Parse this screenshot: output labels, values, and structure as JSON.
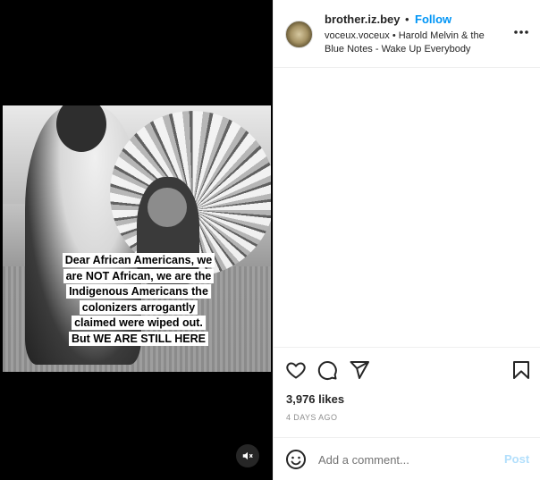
{
  "post": {
    "username": "brother.iz.bey",
    "separator": "•",
    "follow_label": "Follow",
    "audio_line": "voceux.voceux • Harold Melvin & the Blue Notes - Wake Up Everybody",
    "more_icon": "more-horizontal-icon"
  },
  "media": {
    "caption_lines": [
      "Dear African Americans, we",
      "are NOT African, we are the",
      "Indigenous Americans the",
      "colonizers arrogantly",
      "claimed were wiped out.",
      "But WE ARE STILL HERE"
    ],
    "mute_icon": "speaker-muted-icon"
  },
  "actions": {
    "icons": [
      "heart-icon",
      "comment-icon",
      "share-icon",
      "bookmark-icon"
    ],
    "likes": "3,976 likes",
    "date": "4 DAYS AGO"
  },
  "comment": {
    "emoji_icon": "emoji-icon",
    "placeholder": "Add a comment...",
    "post_label": "Post",
    "post_color": "#b2dffc"
  },
  "colors": {
    "link_blue": "#0095f6",
    "text": "#262626",
    "muted": "#8e8e8e"
  }
}
